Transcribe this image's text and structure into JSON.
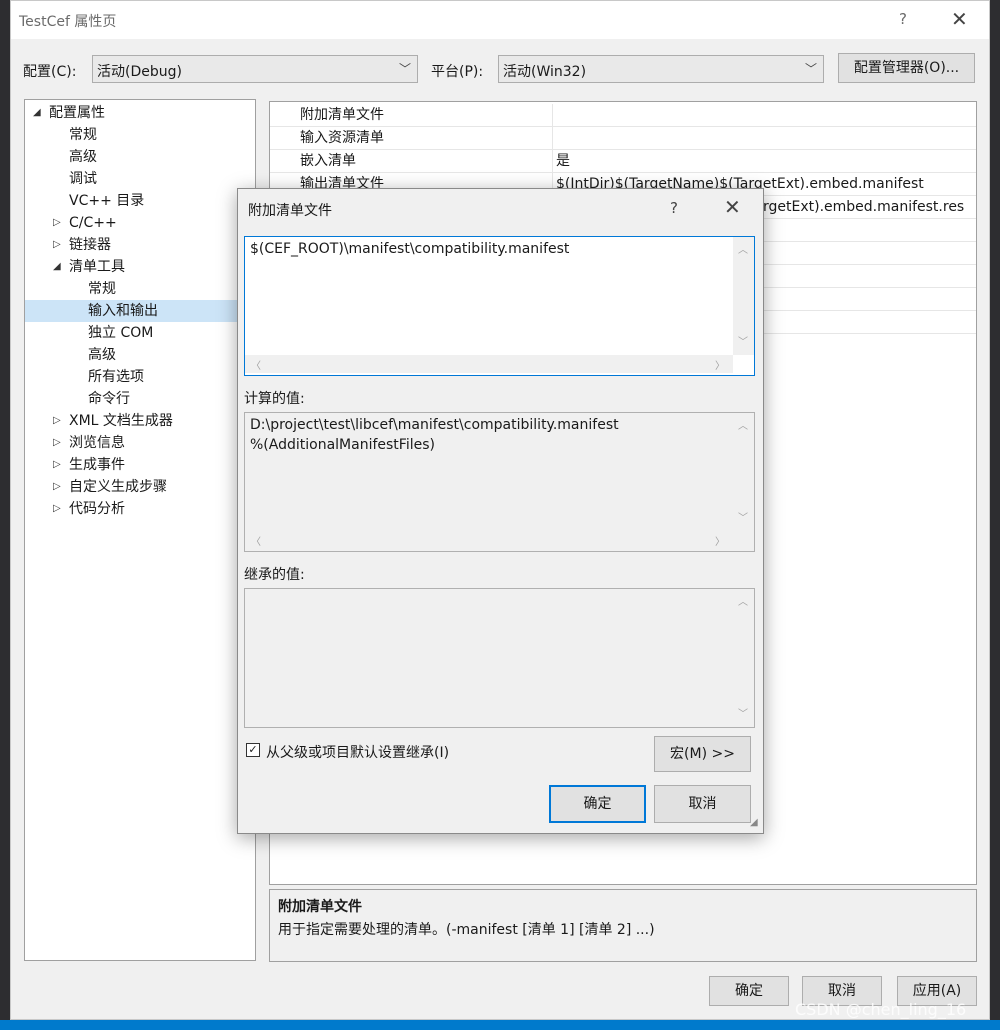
{
  "window": {
    "title": "TestCef 属性页",
    "help_glyph": "?",
    "close_glyph": "✕"
  },
  "toolbar": {
    "config_label": "配置(C):",
    "config_value": "活动(Debug)",
    "platform_label": "平台(P):",
    "platform_value": "活动(Win32)",
    "config_manager_label": "配置管理器(O)..."
  },
  "tree": {
    "items": [
      {
        "label": "配置属性",
        "toggle": "◢"
      },
      {
        "label": "常规"
      },
      {
        "label": "高级"
      },
      {
        "label": "调试"
      },
      {
        "label": "VC++ 目录"
      },
      {
        "label": "C/C++",
        "toggle": "▷"
      },
      {
        "label": "链接器",
        "toggle": "▷"
      },
      {
        "label": "清单工具",
        "toggle": "◢"
      },
      {
        "label": "常规"
      },
      {
        "label": "输入和输出"
      },
      {
        "label": "独立 COM"
      },
      {
        "label": "高级"
      },
      {
        "label": "所有选项"
      },
      {
        "label": "命令行"
      },
      {
        "label": "XML 文档生成器",
        "toggle": "▷"
      },
      {
        "label": "浏览信息",
        "toggle": "▷"
      },
      {
        "label": "生成事件",
        "toggle": "▷"
      },
      {
        "label": "自定义生成步骤",
        "toggle": "▷"
      },
      {
        "label": "代码分析",
        "toggle": "▷"
      }
    ]
  },
  "grid": {
    "rows": [
      {
        "name": "附加清单文件",
        "value": ""
      },
      {
        "name": "输入资源清单",
        "value": ""
      },
      {
        "name": "嵌入清单",
        "value": "是"
      },
      {
        "name": "输出清单文件",
        "value": "$(IntDir)$(TargetName)$(TargetExt).embed.manifest"
      },
      {
        "name": "",
        "value": "rgetExt).embed.manifest.res"
      }
    ]
  },
  "description": {
    "title": "附加清单文件",
    "text": "用于指定需要处理的清单。(-manifest [清单 1] [清单 2] ...)"
  },
  "dialog": {
    "title": "附加清单文件",
    "help_glyph": "?",
    "close_glyph": "✕",
    "input_value": "$(CEF_ROOT)\\manifest\\compatibility.manifest",
    "computed_label": "计算的值:",
    "computed_line1": "D:\\project\\test\\libcef\\manifest\\compatibility.manifest",
    "computed_line2": "%(AdditionalManifestFiles)",
    "inherited_label": "继承的值:",
    "inherit_checkbox_label": "从父级或项目默认设置继承(I)",
    "inherit_checked": true,
    "macro_button": "宏(M) >>",
    "ok_button": "确定",
    "cancel_button": "取消"
  },
  "footer": {
    "ok": "确定",
    "cancel": "取消",
    "apply": "应用(A)"
  },
  "watermark": "CSDN @chen_ling_16",
  "colors": {
    "selection": "#cce4f7",
    "primary_border": "#0078d7",
    "ide_accent": "#007acc"
  }
}
